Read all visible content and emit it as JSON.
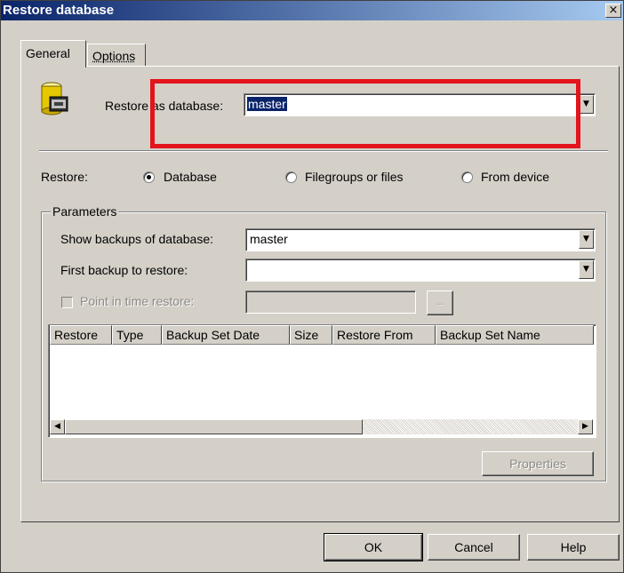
{
  "window": {
    "title": "Restore database",
    "close_glyph": "×"
  },
  "tabs": [
    {
      "label": "General",
      "active": true
    },
    {
      "label": "Options",
      "active": false
    }
  ],
  "restore_as": {
    "label": "Restore as database:",
    "value": "master",
    "icon": "database-restore-icon"
  },
  "restore": {
    "label": "Restore:",
    "options": [
      {
        "label": "Database",
        "checked": true
      },
      {
        "label": "Filegroups or files",
        "checked": false
      },
      {
        "label": "From device",
        "checked": false
      }
    ]
  },
  "parameters": {
    "title": "Parameters",
    "show_backups_label": "Show backups of database:",
    "show_backups_value": "master",
    "first_backup_label": "First backup to restore:",
    "first_backup_value": "",
    "point_in_time_label": "Point in time restore:",
    "point_in_time_value": "",
    "browse_label": "..."
  },
  "grid": {
    "columns": [
      "Restore",
      "Type",
      "Backup Set Date",
      "Size",
      "Restore From",
      "Backup Set Name"
    ],
    "rows": []
  },
  "buttons": {
    "properties": "Properties",
    "ok": "OK",
    "cancel": "Cancel",
    "help": "Help"
  },
  "colors": {
    "highlight_box": "#e3141b",
    "title_bar": "#0a246a",
    "dialog_face": "#d4d0c8"
  }
}
